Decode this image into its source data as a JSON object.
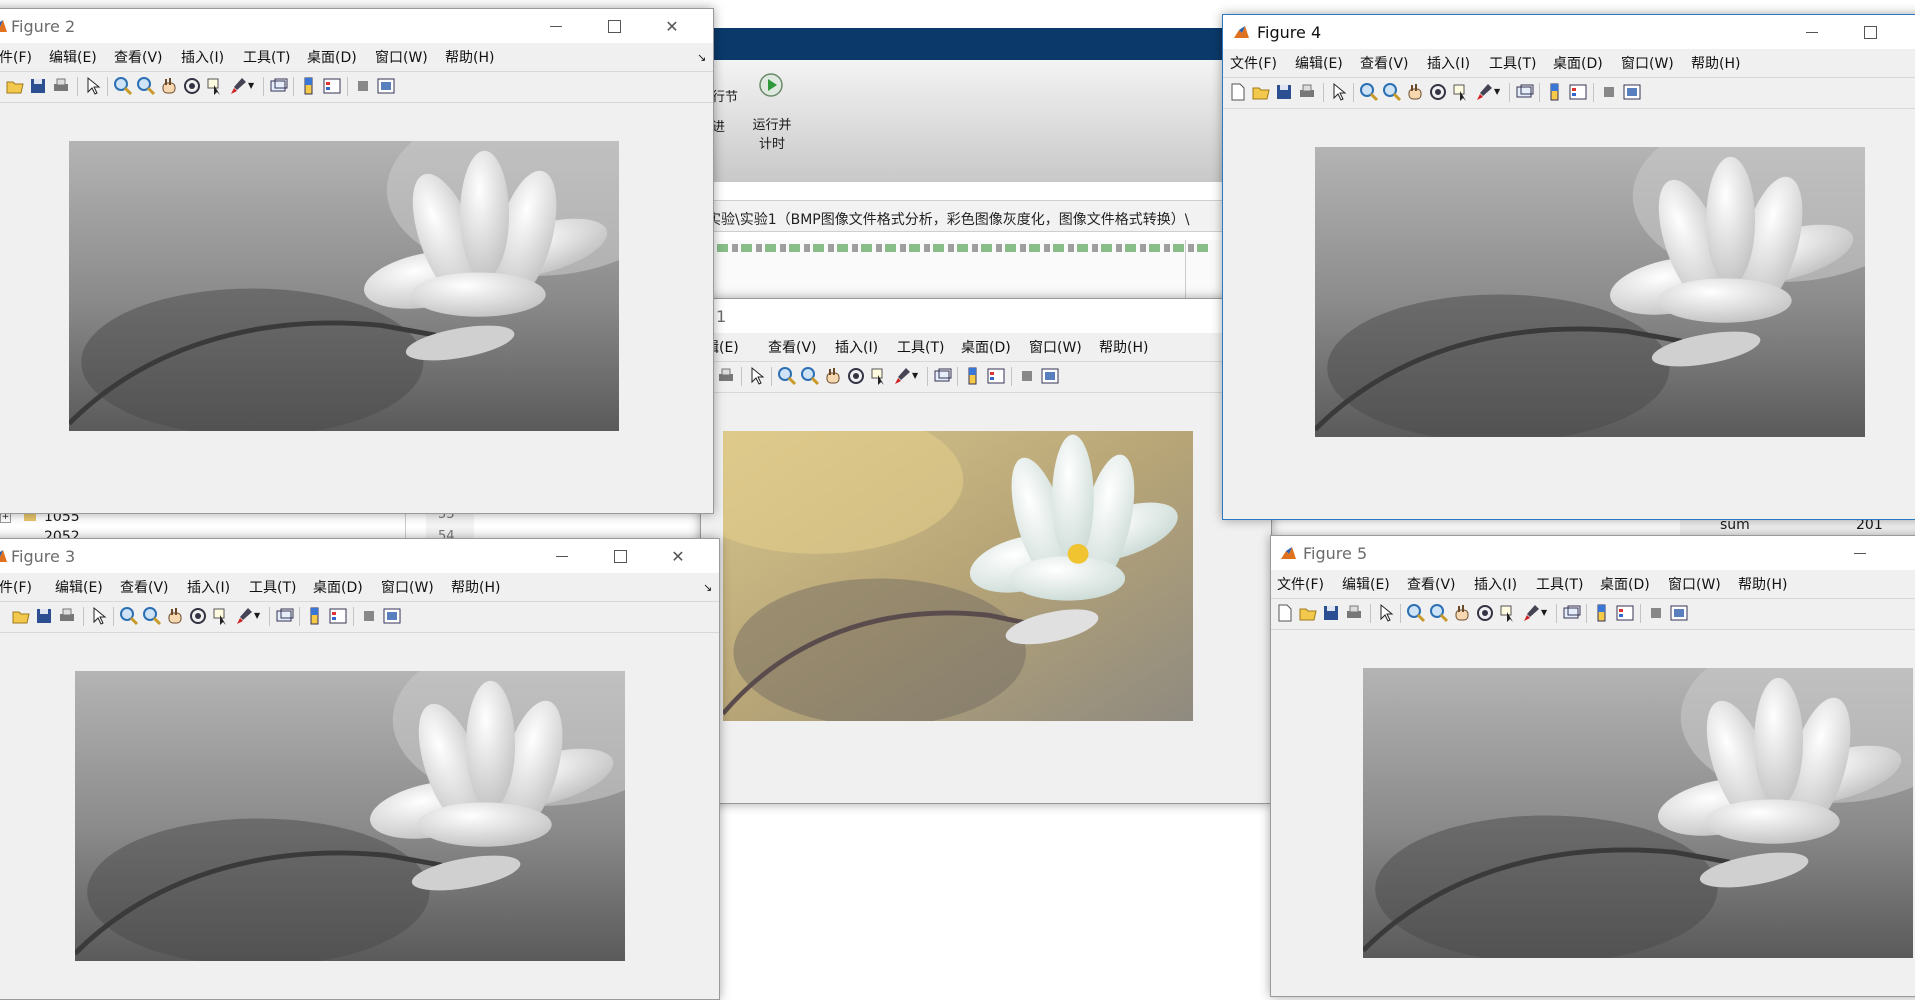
{
  "menu_labels": {
    "file": "文件(F)",
    "file_cut": "件(F)",
    "edit": "编辑(E)",
    "edit_cut": "辑(E)",
    "view": "查看(V)",
    "insert": "插入(I)",
    "tools": "工具(T)",
    "desktop": "桌面(D)",
    "window": "窗口(W)",
    "help": "帮助(H)",
    "dock": "↘"
  },
  "figures": {
    "fig1": {
      "title": "1"
    },
    "fig2": {
      "title": "Figure 2"
    },
    "fig3": {
      "title": "Figure 3"
    },
    "fig4": {
      "title": "Figure 4"
    },
    "fig5": {
      "title": "Figure 5"
    }
  },
  "background_app": {
    "ribbon_button_1": "行节",
    "ribbon_button_1b": "进",
    "ribbon_button_2_line1": "运行并",
    "ribbon_button_2_line2": "计时",
    "path": "实验\\实验1（BMP图像文件格式分析，彩色图像灰度化，图像文件格式转换）\\",
    "code_line": "（） ，",
    "folder_1055": "1055",
    "folder_2052": "2052",
    "line_53": "53",
    "line_54": "54",
    "ws_var_name": "sum",
    "ws_var_value": "201"
  },
  "colors": {
    "active_border": "#2b79c4",
    "ribbon_blue": "#0b3a6a"
  }
}
